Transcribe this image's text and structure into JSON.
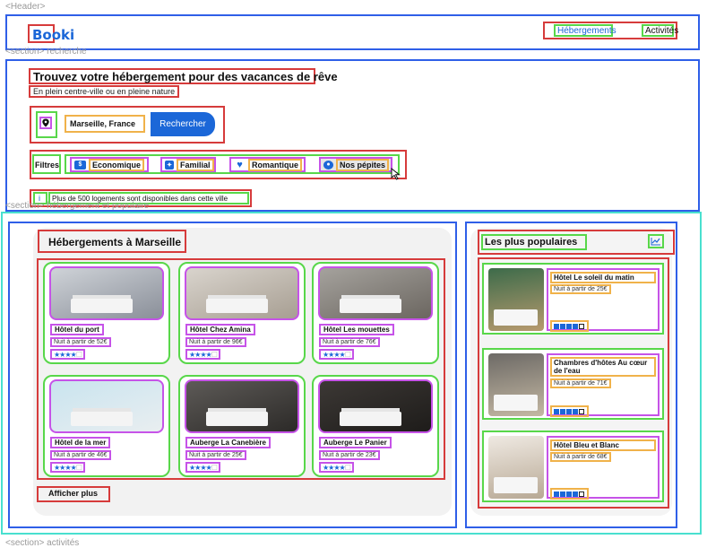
{
  "tags": {
    "header": "<Header>",
    "search_section": "<section> recherche",
    "hosting_section": "<section> hébergement et populaire",
    "activities_section": "<section> activités"
  },
  "header": {
    "logo": "Booki",
    "nav": [
      "Hébergements",
      "Activités"
    ]
  },
  "search": {
    "title": "Trouvez votre hébergement pour des vacances de rêve",
    "subtitle": "En plein centre-ville ou en pleine nature",
    "location_value": "Marseille, France",
    "button": "Rechercher"
  },
  "filters": {
    "label": "Filtres",
    "items": [
      {
        "label": "Economique",
        "icon": "money-icon"
      },
      {
        "label": "Familial",
        "icon": "family-icon"
      },
      {
        "label": "Romantique",
        "icon": "heart-icon"
      },
      {
        "label": "Nos pépites",
        "icon": "gem-icon"
      }
    ]
  },
  "info": {
    "icon": "i",
    "text": "Plus de 500 logements sont disponibles dans cette ville"
  },
  "hostings": {
    "title": "Hébergements à Marseille",
    "show_more": "Afficher plus",
    "cards": [
      {
        "name": "Hôtel du port",
        "price": "Nuit à partir de 52€",
        "rating": 4
      },
      {
        "name": "Hôtel Chez Amina",
        "price": "Nuit à partir de 96€",
        "rating": 4
      },
      {
        "name": "Hôtel Les mouettes",
        "price": "Nuit à partir de 76€",
        "rating": 4
      },
      {
        "name": "Hôtel de la mer",
        "price": "Nuit à partir de 46€",
        "rating": 4
      },
      {
        "name": "Auberge La Canebière",
        "price": "Nuit à partir de 25€",
        "rating": 4
      },
      {
        "name": "Auberge Le Panier",
        "price": "Nuit à partir de 23€",
        "rating": 4
      }
    ]
  },
  "popular": {
    "title": "Les plus populaires",
    "icon": "trend-icon",
    "items": [
      {
        "name": "Hôtel Le soleil du matin",
        "price": "Nuit à partir de 25€",
        "rating": 4
      },
      {
        "name": "Chambres d'hôtes Au cœur de l'eau",
        "price": "Nuit à partir de 71€",
        "rating": 4
      },
      {
        "name": "Hôtel Bleu et Blanc",
        "price": "Nuit à partir de 68€",
        "rating": 4
      }
    ]
  },
  "colors": {
    "accent": "#1b67d8",
    "wire_blue": "#2f5fe8",
    "wire_red": "#d63b3b",
    "wire_green": "#58d74a",
    "wire_purple": "#c653e8",
    "wire_orange": "#f0b24a",
    "wire_cyan": "#49e0cf"
  }
}
